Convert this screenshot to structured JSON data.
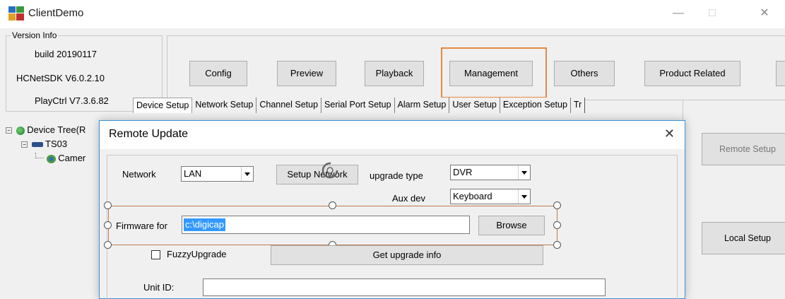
{
  "window": {
    "title": "ClientDemo",
    "minimize": "—",
    "maximize": "□",
    "close": "✕"
  },
  "version_info": {
    "legend": "Version Info",
    "build": "build 20190117",
    "sdk": "HCNetSDK V6.0.2.10",
    "playctrl": "PlayCtrl V7.3.6.82"
  },
  "toolbar": {
    "config": "Config",
    "preview": "Preview",
    "playback": "Playback",
    "management": "Management",
    "others": "Others",
    "product_related": "Product Related"
  },
  "tabs": [
    "Device Setup",
    "Network Setup",
    "Channel Setup",
    "Serial Port Setup",
    "Alarm Setup",
    "User Setup",
    "Exception Setup",
    "Tr"
  ],
  "tree": {
    "root": "Device Tree(R",
    "device": "TS03",
    "camera": "Camer"
  },
  "right_panel": {
    "remote_setup": "Remote Setup",
    "local_setup": "Local Setup"
  },
  "dialog": {
    "title": "Remote Update",
    "close": "✕",
    "network_label": "Network",
    "network_value": "LAN",
    "setup_network": "Setup Network",
    "upgrade_type_label": "upgrade type",
    "upgrade_type_value": "DVR",
    "aux_dev_label": "Aux dev",
    "aux_dev_value": "Keyboard",
    "firmware_label": "Firmware for",
    "firmware_path": "c:\\digicap",
    "browse": "Browse",
    "fuzzy_upgrade": "FuzzyUpgrade",
    "get_upgrade_info": "Get upgrade info",
    "unit_id_label": "Unit ID:",
    "unit_id_value": ""
  },
  "colors": {
    "highlight": "#e28b45",
    "selection": "#3399ff",
    "dialog_border": "#3c8fd9"
  }
}
